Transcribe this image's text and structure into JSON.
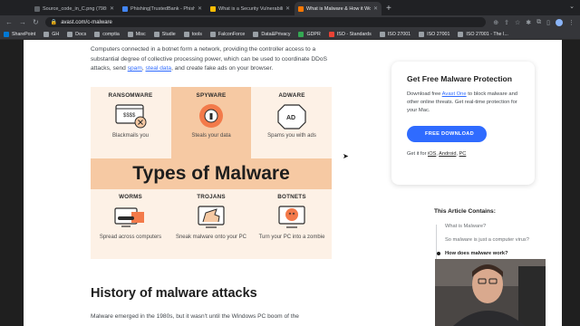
{
  "browser": {
    "tabs": [
      {
        "title": "Source_code_in_C.png (798×...",
        "color": "#5f6368",
        "active": false
      },
      {
        "title": "Phishing|TrustedBank - Phishi...",
        "color": "#4285f4",
        "active": false
      },
      {
        "title": "What is a Security Vulnerabili...",
        "color": "#fbbc04",
        "active": false
      },
      {
        "title": "What is Malware & How it Wor...",
        "color": "#ff7800",
        "active": true
      }
    ],
    "url": "avast.com/c-malware",
    "bookmarks": [
      {
        "label": "SharePoint",
        "color": "#0078d4"
      },
      {
        "label": "GH",
        "color": "#9aa0a6"
      },
      {
        "label": "Docs",
        "color": "#9aa0a6"
      },
      {
        "label": "comptia",
        "color": "#9aa0a6"
      },
      {
        "label": "Misc",
        "color": "#9aa0a6"
      },
      {
        "label": "Studie",
        "color": "#9aa0a6"
      },
      {
        "label": "tools",
        "color": "#9aa0a6"
      },
      {
        "label": "FalconForce",
        "color": "#9aa0a6"
      },
      {
        "label": "Data&Privacy",
        "color": "#9aa0a6"
      },
      {
        "label": "GDPR",
        "color": "#34a853"
      },
      {
        "label": "ISO - Standards",
        "color": "#ea4335"
      },
      {
        "label": "ISO 27001",
        "color": "#9aa0a6"
      },
      {
        "label": "ISO 27001",
        "color": "#9aa0a6"
      },
      {
        "label": "ISO 27001 - The I...",
        "color": "#9aa0a6"
      }
    ]
  },
  "article": {
    "intro_before": "Computers connected in a botnet form a network, providing the controller access to a substantial degree of collective processing power, which can be used to coordinate DDoS attacks, send ",
    "intro_link1": "spam",
    "intro_sep": ", ",
    "intro_link2": "steal data",
    "intro_after": ", and create fake ads on your browser.",
    "infographic": {
      "title": "Types of Malware",
      "cells": [
        {
          "heading": "RANSOMWARE",
          "desc": "Blackmails you"
        },
        {
          "heading": "SPYWARE",
          "desc": "Steals your data"
        },
        {
          "heading": "ADWARE",
          "desc": "Spams you with ads"
        },
        {
          "heading": "WORMS",
          "desc": "Spread across computers"
        },
        {
          "heading": "TROJANS",
          "desc": "Sneak malware onto your PC"
        },
        {
          "heading": "BOTNETS",
          "desc": "Turn your PC into a zombie"
        }
      ],
      "ransom_text": "$$$$",
      "ad_text": "AD",
      "colors": {
        "background": "#fdf1e6",
        "accent": "#f6c9a3",
        "highlight": "#f37a4a"
      }
    },
    "history_heading": "History of malware attacks",
    "history_text": "Malware emerged in the 1980s, but it wasn't until the Windows PC boom of the"
  },
  "sidebar": {
    "card_title": "Get Free Malware Protection",
    "card_text_before": "Download free ",
    "card_link": "Avast One",
    "card_text_after": " to block malware and other online threats. Get real-time protection for your Mac.",
    "download_label": "FREE DOWNLOAD",
    "get_it_for": "Get it for ",
    "platforms": [
      "iOS",
      "Android",
      "PC"
    ],
    "toc_title": "This Article Contains:",
    "toc_items": [
      {
        "label": "What is Malware?",
        "current": false
      },
      {
        "label": "So malware is just a computer virus?",
        "current": false
      },
      {
        "label": "How does malware work?",
        "current": true
      }
    ]
  }
}
